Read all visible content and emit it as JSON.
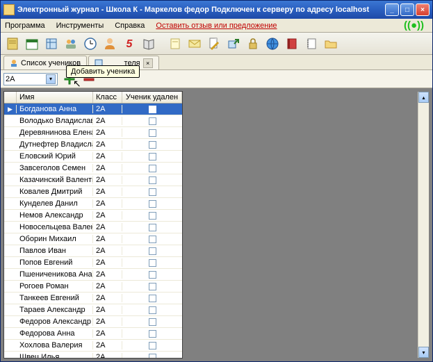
{
  "window": {
    "title": "Электронный журнал - Школа К - Маркелов федор Подключен к серверу по адресу localhost"
  },
  "menu": {
    "program": "Программа",
    "tools": "Инструменты",
    "help": "Справка",
    "feedback": "Оставить отзыв или предложение"
  },
  "tabs": {
    "main": "Список учеников",
    "other_suffix": "теля"
  },
  "tooltip": "Добавить ученика",
  "combo_value": "2А",
  "grid": {
    "headers": {
      "name": "Имя",
      "class": "Класс",
      "deleted": "Ученик удален"
    },
    "rows": [
      {
        "name": "Богданова Анна",
        "class": "2А",
        "selected": true
      },
      {
        "name": "Володько Владислав",
        "class": "2А"
      },
      {
        "name": "Деревянинова Елена",
        "class": "2А"
      },
      {
        "name": "Дутнефтер Владислав",
        "class": "2А"
      },
      {
        "name": "Еловский Юрий",
        "class": "2А"
      },
      {
        "name": "Завсеголов Семен",
        "class": "2А"
      },
      {
        "name": "Казачинский Валентин",
        "class": "2А"
      },
      {
        "name": "Ковалев Дмитрий",
        "class": "2А"
      },
      {
        "name": "Кунделев Данил",
        "class": "2А"
      },
      {
        "name": "Немов Александр",
        "class": "2А"
      },
      {
        "name": "Новосельцева Валентина",
        "class": "2А"
      },
      {
        "name": "Оборин Михаил",
        "class": "2А"
      },
      {
        "name": "Павлов Иван",
        "class": "2А"
      },
      {
        "name": "Попов Евгений",
        "class": "2А"
      },
      {
        "name": "Пшениченикова Анастасия",
        "class": "2А"
      },
      {
        "name": "Рогоев Роман",
        "class": "2А"
      },
      {
        "name": "Танкеев Евгений",
        "class": "2А"
      },
      {
        "name": "Тараев Александр",
        "class": "2А"
      },
      {
        "name": "Федоров Александр",
        "class": "2А"
      },
      {
        "name": "Федорова Анна",
        "class": "2А"
      },
      {
        "name": "Хохлова Валерия",
        "class": "2А"
      },
      {
        "name": "Швец Илья",
        "class": "2А"
      }
    ]
  },
  "toolbar_icons": [
    "journal-icon",
    "calendar-icon",
    "schedule-icon",
    "groups-icon",
    "clock-icon",
    "person-icon",
    "grade5-icon",
    "book-icon",
    "note-icon",
    "mail-icon",
    "doc-icon",
    "export-icon",
    "lock-icon",
    "browser-icon",
    "red-book-icon",
    "spiral-notebook-icon",
    "folder-icon"
  ],
  "colors": {
    "accent": "#316ac5",
    "titlebar": "#2a5fc0",
    "toolbar_bg": "#ece9d8"
  }
}
